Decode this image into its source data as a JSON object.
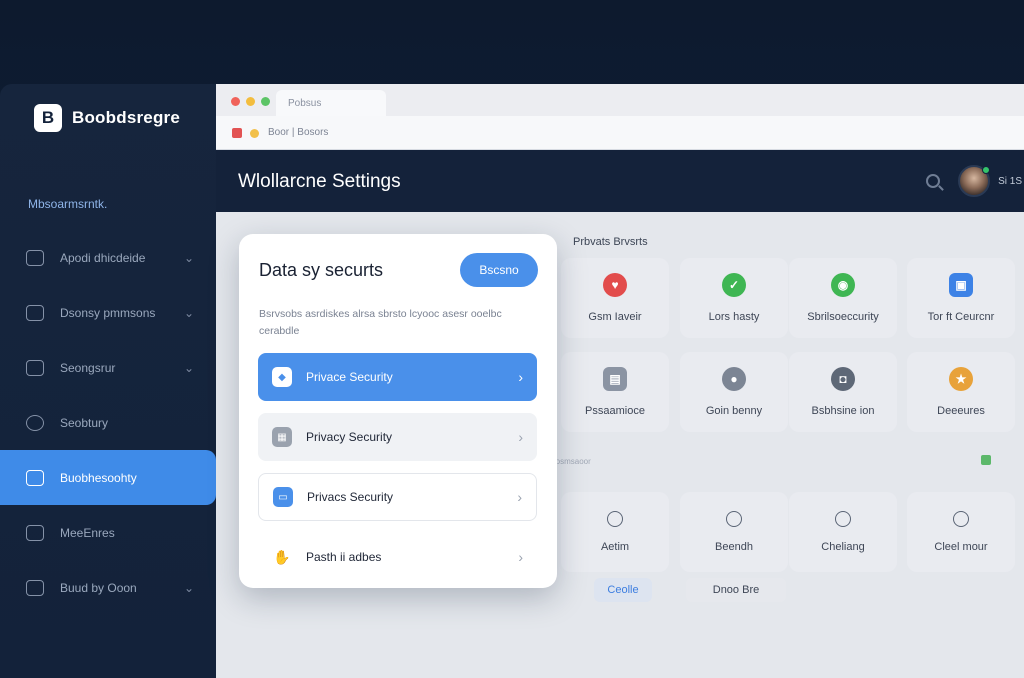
{
  "brand": {
    "logo_letter": "B",
    "name": "Boobdsregre"
  },
  "sidebar": {
    "workspace_label": "Mbsoarmsrntk.",
    "items": [
      {
        "label": "Apodi dhicdeide",
        "icon": "mail-icon",
        "active": false,
        "has_chevron": true
      },
      {
        "label": "Dsonsy pmmsons",
        "icon": "chart-icon",
        "active": false,
        "has_chevron": true
      },
      {
        "label": "Seongsrur",
        "icon": "window-icon",
        "active": false,
        "has_chevron": true
      },
      {
        "label": "Seobtury",
        "icon": "clock-icon",
        "active": false,
        "has_chevron": false
      },
      {
        "label": "Buobhesoohty",
        "icon": "lock-icon",
        "active": true,
        "has_chevron": false
      },
      {
        "label": "MeeEnres",
        "icon": "book-icon",
        "active": false,
        "has_chevron": false
      },
      {
        "label": "Buud by Ooon",
        "icon": "shield-icon",
        "active": false,
        "has_chevron": true
      }
    ]
  },
  "browser": {
    "tab_title": "Pobsus",
    "address": "Boor | Bosors"
  },
  "header": {
    "title": "Wlollarcne Settings"
  },
  "user": {
    "initials": "Si 1S"
  },
  "right_panel": {
    "section_title": "Prbvats Brvsrts",
    "tiles_row1": [
      {
        "label": "Gsm Iaveir",
        "icon": "heart-icon",
        "color": "#e24c4c"
      },
      {
        "label": "Lors hasty",
        "icon": "shield-check-icon",
        "color": "#3fb653"
      },
      {
        "label": "Sbrilsoeccurity",
        "icon": "globe-icon",
        "color": "#3fb653"
      },
      {
        "label": "Tor ft Ceurcnr",
        "icon": "lock-icon",
        "color": "#3d82e6"
      }
    ],
    "tiles_row2": [
      {
        "label": "Pssaamioce",
        "icon": "message-icon",
        "color": "#8b94a3"
      },
      {
        "label": "Goin benny",
        "icon": "person-icon",
        "color": "#7c8594"
      },
      {
        "label": "Bsbhsine ion",
        "icon": "camera-icon",
        "color": "#5e6877"
      },
      {
        "label": "Deeeures",
        "icon": "star-icon",
        "color": "#e8a23a"
      }
    ],
    "mid_caption": "rosmsaoor",
    "tiles_row3": [
      {
        "label": "Aetim",
        "icon": "headset-icon"
      },
      {
        "label": "Beendh",
        "icon": "circle-icon"
      },
      {
        "label": "Cheliang",
        "icon": "hand-icon"
      },
      {
        "label": "Cleel mour",
        "icon": "bag-icon"
      }
    ],
    "pill_left": "Ceolle",
    "pill_right": "Dnoo Bre"
  },
  "card": {
    "title": "Data sy securts",
    "button_label": "Bscsno",
    "description": "Bsrvsobs asrdiskes alrsa sbrsto lcyooc asesr ooelbc cerabdle",
    "options": [
      {
        "label": "Privace Security",
        "icon": "shield-icon",
        "style": "active"
      },
      {
        "label": "Privacy Security",
        "icon": "grid-icon",
        "style": "grey"
      },
      {
        "label": "Privacs Security",
        "icon": "id-card-icon",
        "style": "outline"
      },
      {
        "label": "Pasth ii adbes",
        "icon": "hand-icon",
        "style": "plain"
      }
    ]
  },
  "colors": {
    "accent": "#4a90ea",
    "sidebar_active": "#3f8be8",
    "header_bg": "#14223a",
    "sidebar_bg": "#16253d"
  }
}
